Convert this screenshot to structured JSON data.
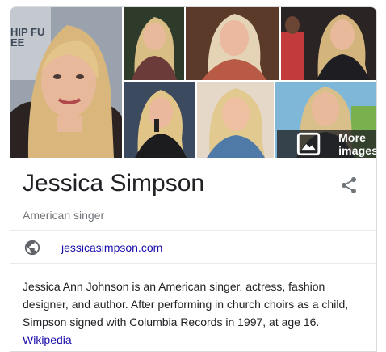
{
  "gallery": {
    "more_images_label": "More images",
    "photo_sign_text": "HIP FU\nEE"
  },
  "knowledge_panel": {
    "title": "Jessica Simpson",
    "subtitle": "American singer",
    "website": "jessicasimpson.com",
    "description": "Jessica Ann Johnson is an American singer, actress, fashion designer, and author. After performing in church choirs as a child, Simpson signed with Columbia Records in 1997, at age 16.",
    "source_link": "Wikipedia"
  },
  "colors": {
    "link": "#1a0dab",
    "secondary_text": "#70757a",
    "divider": "#e8eaed"
  }
}
